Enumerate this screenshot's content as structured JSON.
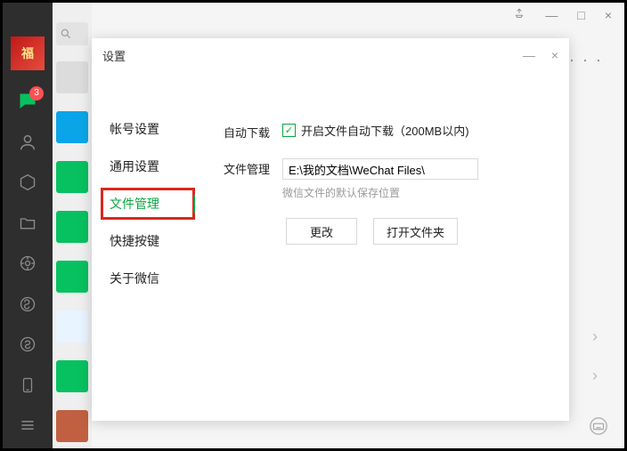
{
  "sidebar": {
    "avatar_text": "福",
    "chat_badge": "3"
  },
  "chat_list": {
    "items": [
      {
        "color": "#dcdcdc"
      },
      {
        "color": "#0aa5e8"
      },
      {
        "color": "#07c160"
      },
      {
        "color": "#07c160"
      },
      {
        "color": "#07c160"
      },
      {
        "color": "#e8f4ff"
      },
      {
        "color": "#07c160"
      },
      {
        "color": "#c06040"
      }
    ]
  },
  "window": {
    "pin": "⊤",
    "min": "—",
    "max": "□",
    "close": "×",
    "more": "· · ·"
  },
  "settings": {
    "title": "设置",
    "tabs": {
      "account": "帐号设置",
      "general": "通用设置",
      "files": "文件管理",
      "shortcut": "快捷按键",
      "about": "关于微信"
    },
    "auto_download": {
      "label": "自动下载",
      "checkbox_text": "开启文件自动下载（200MB以内)",
      "checked": true
    },
    "file_mgmt": {
      "label": "文件管理",
      "path": "E:\\我的文档\\WeChat Files\\",
      "hint": "微信文件的默认保存位置",
      "change_btn": "更改",
      "open_btn": "打开文件夹"
    }
  },
  "right_panel": {
    "chevron": "›"
  }
}
